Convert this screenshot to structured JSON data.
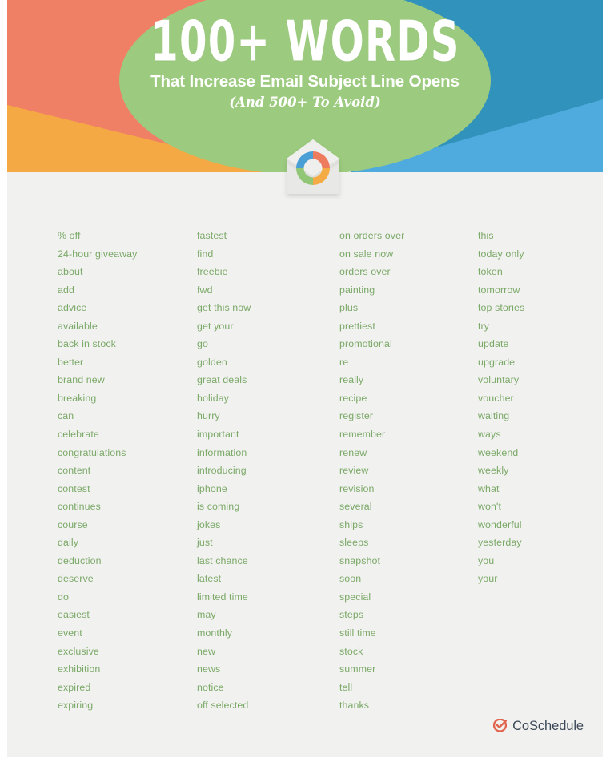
{
  "header": {
    "title": "100+ WORDS",
    "subtitle": "That Increase Email Subject Line Opens",
    "subtitle2": "(And 500+ To Avoid)",
    "logo_icon": "envelope-donut-icon",
    "colors": {
      "green_oval": "#9ccb7f",
      "salmon": "#ef8065",
      "orange": "#f5a945",
      "dark_blue": "#3193bb",
      "light_blue": "#4fabdd",
      "sheet_background": "#f1f1ef"
    }
  },
  "word_list": {
    "text_color": "#7ba968",
    "columns": [
      {
        "name": "column-1",
        "words": [
          "% off",
          "24-hour giveaway",
          "about",
          "add",
          "advice",
          "available",
          "back in stock",
          "better",
          "brand new",
          "breaking",
          "can",
          "celebrate",
          "congratulations",
          "content",
          "contest",
          "continues",
          "course",
          "daily",
          "deduction",
          "deserve",
          "do",
          "easiest",
          "event",
          "exclusive",
          "exhibition",
          "expired",
          "expiring"
        ]
      },
      {
        "name": "column-2",
        "words": [
          "fastest",
          "find",
          "freebie",
          "fwd",
          "get this now",
          "get your",
          "go",
          "golden",
          "great deals",
          "holiday",
          "hurry",
          "important",
          "information",
          "introducing",
          "iphone",
          "is coming",
          "jokes",
          "just",
          "last chance",
          "latest",
          "limited time",
          "may",
          "monthly",
          "new",
          "news",
          "notice",
          "off selected"
        ]
      },
      {
        "name": "column-3",
        "words": [
          "on orders over",
          "on sale now",
          "orders over",
          "painting",
          "plus",
          "prettiest",
          "promotional",
          "re",
          "really",
          "recipe",
          "register",
          "remember",
          "renew",
          "review",
          "revision",
          "several",
          "ships",
          "sleeps",
          "snapshot",
          "soon",
          "special",
          "steps",
          "still time",
          "stock",
          "summer",
          "tell",
          "thanks"
        ]
      },
      {
        "name": "column-4",
        "words": [
          "this",
          "today only",
          "token",
          "tomorrow",
          "top stories",
          "try",
          "update",
          "upgrade",
          "voluntary",
          "voucher",
          "waiting",
          "ways",
          "weekend",
          "weekly",
          "what",
          "won't",
          "wonderful",
          "yesterday",
          "you",
          "your"
        ]
      }
    ]
  },
  "footer": {
    "brand": "CoSchedule",
    "mark_icon": "coschedule-check-circle-icon",
    "mark_color": "#e1654f",
    "text_color": "#3c4858"
  }
}
